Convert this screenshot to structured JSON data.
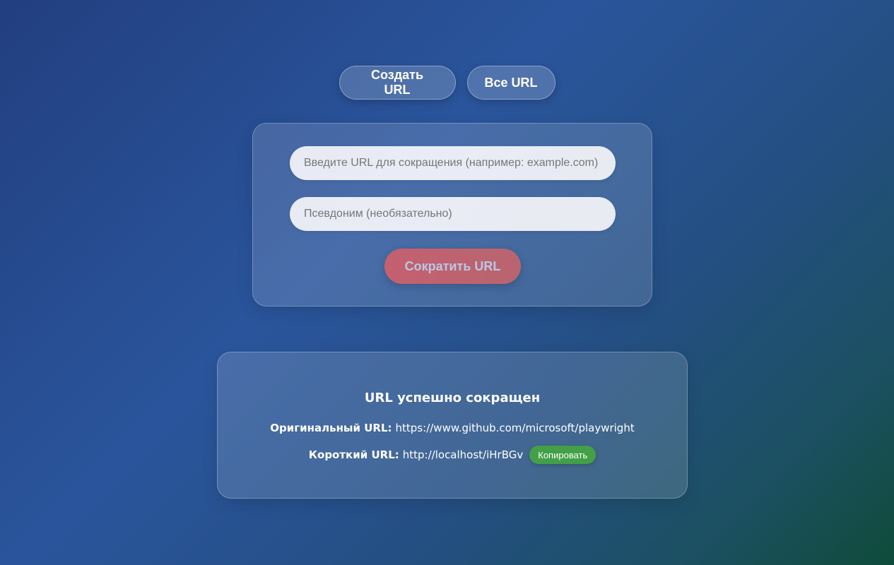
{
  "nav": {
    "create_label": "Создать URL",
    "all_label": "Все URL"
  },
  "form": {
    "url_placeholder": "Введите URL для сокращения (например: example.com)",
    "url_value": "",
    "alias_placeholder": "Псевдоним (необязательно)",
    "alias_value": "",
    "submit_label": "Сократить URL"
  },
  "result": {
    "title": "URL успешно сокращен",
    "original_label": "Оригинальный URL:",
    "original_value": "https://www.github.com/microsoft/playwright",
    "short_label": "Короткий URL:",
    "short_value": "http://localhost/iHrBGv",
    "copy_label": "Копировать"
  },
  "colors": {
    "background_start": "#223f80",
    "background_end": "#0f4b3a",
    "submit_button": "#c4606f",
    "copy_button": "#43a047"
  }
}
